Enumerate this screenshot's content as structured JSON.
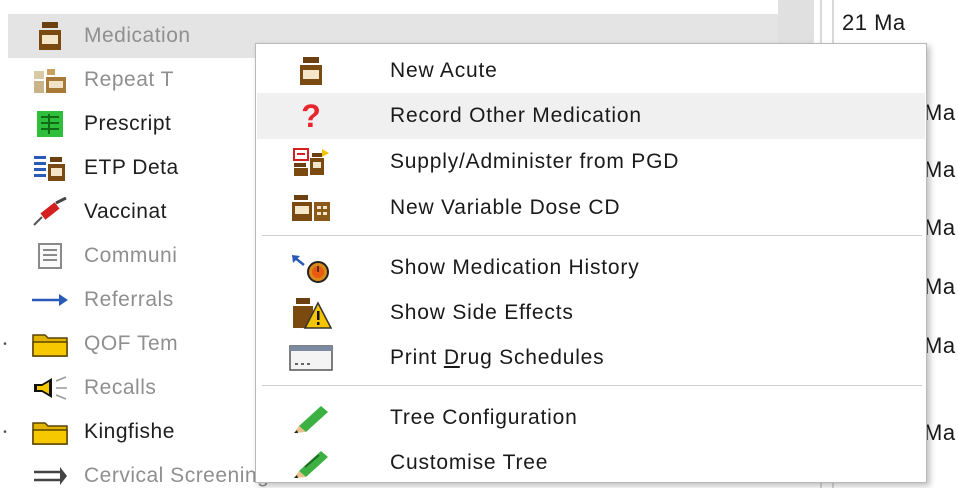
{
  "tree": {
    "items": [
      {
        "label": "Medication",
        "icon": "medication-bottle-icon"
      },
      {
        "label": "Repeat T",
        "icon": "repeat-templates-icon"
      },
      {
        "label": "Prescript",
        "icon": "prescription-icon"
      },
      {
        "label": "ETP Deta",
        "icon": "etp-details-icon"
      },
      {
        "label": "Vaccinat",
        "icon": "syringe-icon"
      },
      {
        "label": "Communi",
        "icon": "document-icon"
      },
      {
        "label": "Referrals",
        "icon": "arrow-right-icon"
      },
      {
        "label": "QOF Tem",
        "icon": "folder-icon"
      },
      {
        "label": "Recalls",
        "icon": "megaphone-icon"
      },
      {
        "label": "Kingfishe",
        "icon": "folder-icon"
      },
      {
        "label": "Cervical Screening",
        "icon": "double-arrow-icon"
      }
    ]
  },
  "dates": {
    "first": "21 Ma",
    "rows": [
      "Ma",
      "Ma",
      "Ma",
      "Ma",
      "Ma",
      "Ma",
      "Ma",
      "21 Ma"
    ]
  },
  "context_menu": {
    "items": [
      {
        "label": "New Acute",
        "icon": "medication-bottle-icon"
      },
      {
        "label": "Record Other Medication",
        "icon": "question-mark-icon"
      },
      {
        "label": "Supply/Administer from PGD",
        "icon": "pgd-icon"
      },
      {
        "label": "New Variable Dose CD",
        "icon": "variable-dose-icon"
      },
      {
        "label": "Show Medication History",
        "icon": "history-clock-icon"
      },
      {
        "label": "Show Side Effects",
        "icon": "warning-icon"
      },
      {
        "label_before": "Print ",
        "label_mnemonic": "D",
        "label_after": "rug Schedules",
        "icon": "schedule-window-icon"
      },
      {
        "label": "Tree Configuration",
        "icon": "pencil-icon"
      },
      {
        "label": "Customise Tree",
        "icon": "pencil-edit-icon"
      }
    ]
  },
  "colors": {
    "selection": "#e4e4e4",
    "menu_hover": "#f0f0f0",
    "brown": "#7a4a10",
    "red": "#e8242c",
    "green": "#3cb043",
    "yellow": "#f5c400"
  }
}
